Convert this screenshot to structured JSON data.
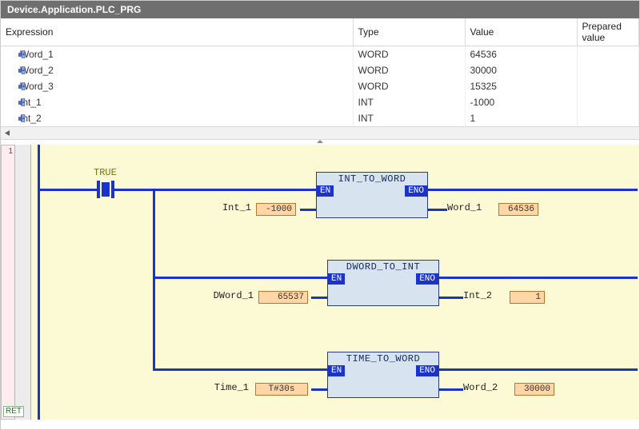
{
  "title": "Device.Application.PLC_PRG",
  "columns": {
    "expression": "Expression",
    "type": "Type",
    "value": "Value",
    "prepared": "Prepared value"
  },
  "rows": [
    {
      "name": "Word_1",
      "type": "WORD",
      "value": "64536",
      "prepared": ""
    },
    {
      "name": "Word_2",
      "type": "WORD",
      "value": "30000",
      "prepared": ""
    },
    {
      "name": "Word_3",
      "type": "WORD",
      "value": "15325",
      "prepared": ""
    },
    {
      "name": "Int_1",
      "type": "INT",
      "value": "-1000",
      "prepared": ""
    },
    {
      "name": "Int_2",
      "type": "INT",
      "value": "1",
      "prepared": ""
    }
  ],
  "ladder": {
    "line_no": "1",
    "ret": "RET",
    "contact_label": "TRUE",
    "blocks": [
      {
        "name": "INT_TO_WORD",
        "en": "EN",
        "eno": "ENO",
        "in_var": "Int_1",
        "in_val": "-1000",
        "out_var": "Word_1",
        "out_val": "64536"
      },
      {
        "name": "DWORD_TO_INT",
        "en": "EN",
        "eno": "ENO",
        "in_var": "DWord_1",
        "in_val": "65537",
        "out_var": "Int_2",
        "out_val": "1"
      },
      {
        "name": "TIME_TO_WORD",
        "en": "EN",
        "eno": "ENO",
        "in_var": "Time_1",
        "in_val": "T#30s",
        "out_var": "Word_2",
        "out_val": "30000"
      }
    ]
  }
}
